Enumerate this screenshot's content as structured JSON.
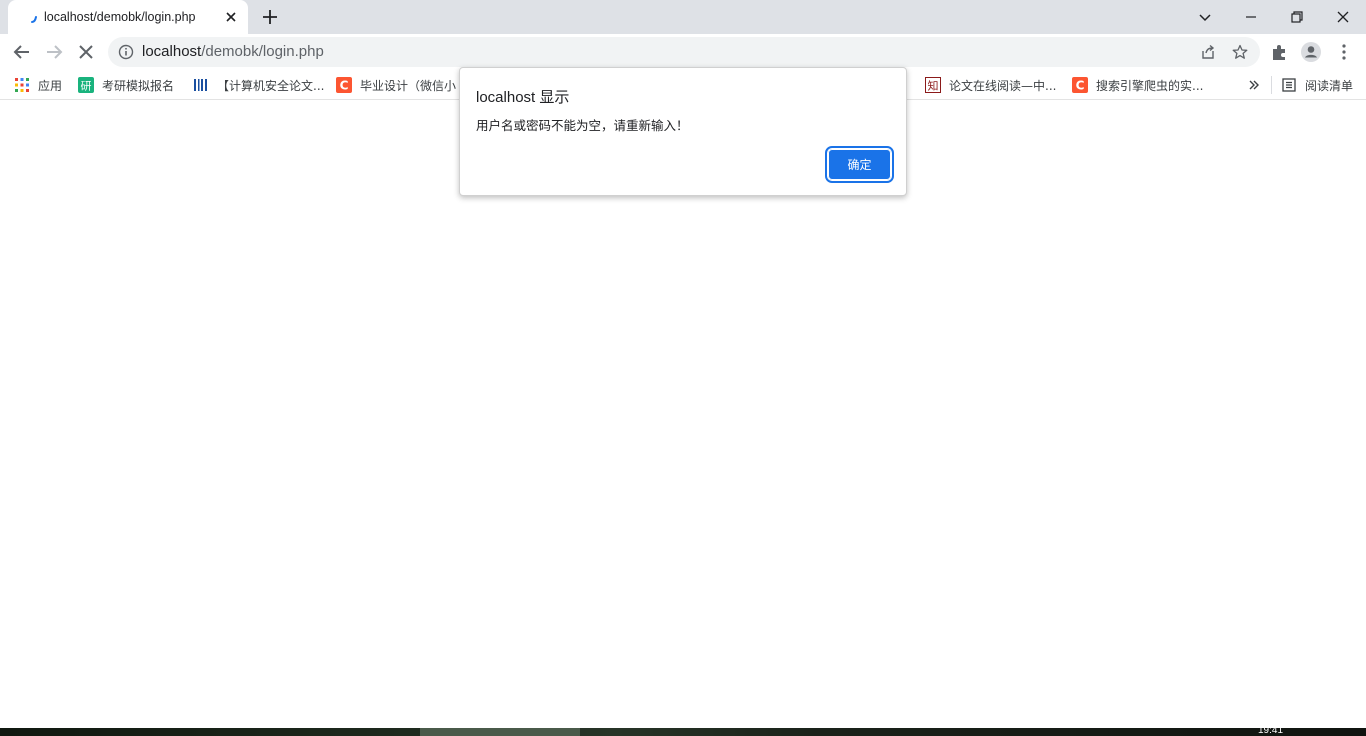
{
  "tab": {
    "title": "localhost/demobk/login.php",
    "favicon": "loading-spinner-icon"
  },
  "window_controls": [
    "chevron-down-icon",
    "minimize-icon",
    "restore-icon",
    "close-icon"
  ],
  "address_bar": {
    "url_host": "localhost",
    "url_path": "/demobk/login.php"
  },
  "bookmarks": [
    {
      "label": "应用",
      "icon": "apps-grid-icon"
    },
    {
      "label": "考研模拟报名",
      "icon": "yan-icon",
      "icon_text": "研"
    },
    {
      "label": "【计算机安全论文...",
      "icon": "barcode-icon"
    },
    {
      "label": "毕业设计（微信小",
      "icon": "csdn-icon",
      "icon_text": "C"
    },
    {
      "label": "论文在线阅读—中...",
      "icon": "zhi-icon",
      "icon_text": "知"
    },
    {
      "label": "搜索引擎爬虫的实...",
      "icon": "csdn-icon",
      "icon_text": "C"
    }
  ],
  "reading_list": {
    "label": "阅读清单",
    "icon": "reading-list-icon"
  },
  "dialog": {
    "title": "localhost 显示",
    "message": "用户名或密码不能为空，请重新输入！",
    "ok_label": "确定"
  },
  "taskbar": {
    "clock": "19:41"
  },
  "colors": {
    "tabstrip": "#dee1e6",
    "accent": "#1a73e8",
    "csdn": "#fc5531",
    "yan": "#19b37d"
  }
}
